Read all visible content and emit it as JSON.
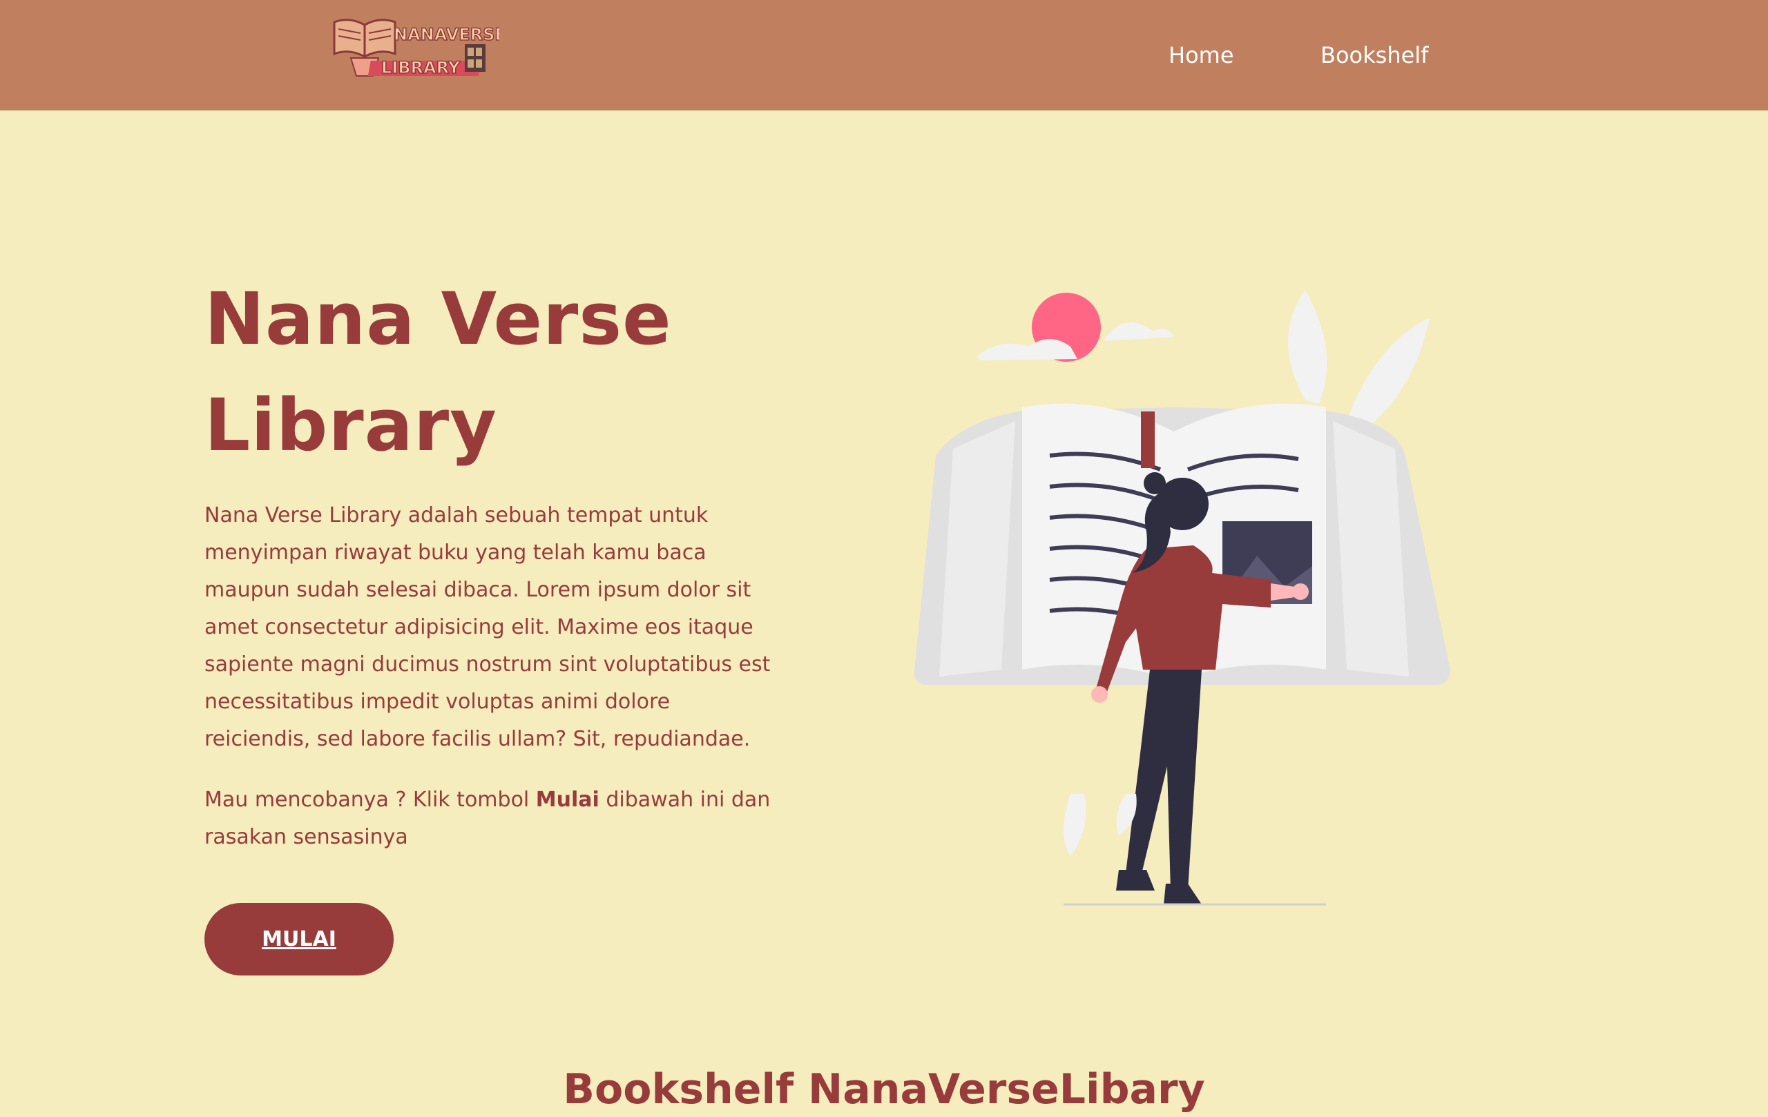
{
  "header": {
    "logo_line1": "NANAVERSE",
    "logo_line2": "LIBRARY",
    "nav": [
      {
        "label": "Home"
      },
      {
        "label": "Bookshelf"
      }
    ]
  },
  "hero": {
    "title_line1": "Nana Verse",
    "title_line2": "Library",
    "description": "Nana Verse Library adalah sebuah tempat untuk menyimpan riwayat buku yang telah kamu baca maupun sudah selesai dibaca. Lorem ipsum dolor sit amet consectetur adipisicing elit. Maxime eos itaque sapiente magni ducimus nostrum sint voluptatibus est necessitatibus impedit voluptas animi dolore reiciendis, sed labore facilis ullam? Sit, repudiandae.",
    "cta_prefix": "Mau mencobanya ? Klik tombol ",
    "cta_bold": "Mulai",
    "cta_suffix": " dibawah ini dan rasakan sensasinya",
    "button_label": "MULAI"
  },
  "bookshelf_section": {
    "title": "Bookshelf NanaVerseLibary"
  },
  "colors": {
    "header_bg": "#c08060",
    "page_bg": "#f5edbd",
    "accent": "#973b3b"
  }
}
